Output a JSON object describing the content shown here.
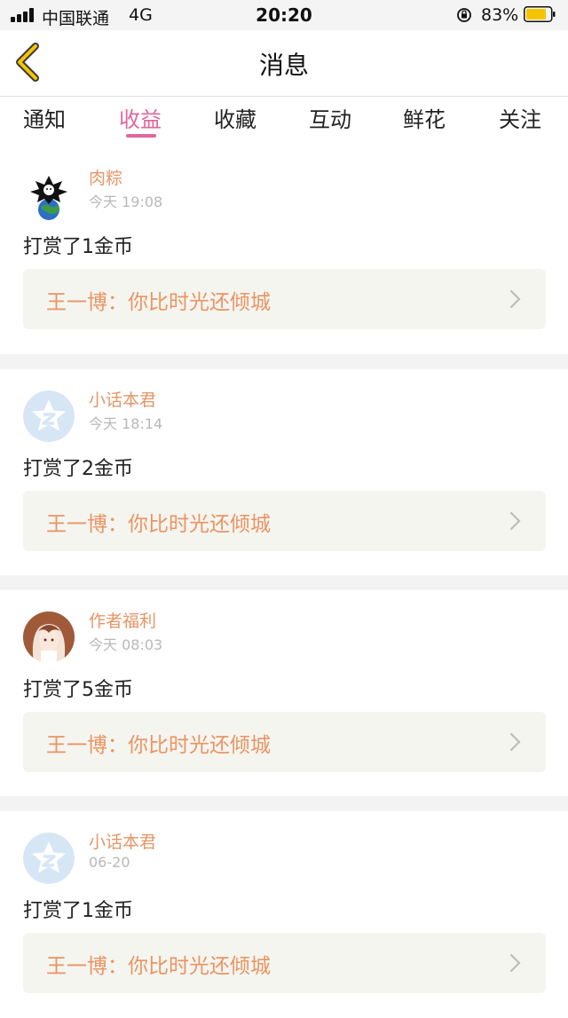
{
  "status_bar": {
    "carrier": "中国联通",
    "network": "4G",
    "time": "20:20",
    "battery": "83%"
  },
  "header": {
    "title": "消息"
  },
  "tabs": [
    {
      "label": "通知"
    },
    {
      "label": "收益",
      "active": true
    },
    {
      "label": "收藏"
    },
    {
      "label": "互动"
    },
    {
      "label": "鲜花"
    },
    {
      "label": "关注"
    }
  ],
  "messages": [
    {
      "user": "肉粽",
      "time": "今天 19:08",
      "action": "打赏了1金币",
      "book": "王一博：你比时光还倾城",
      "avatar": "wolf-earth-avatar"
    },
    {
      "user": "小话本君",
      "time": "今天 18:14",
      "action": "打赏了2金币",
      "book": "王一博：你比时光还倾城",
      "avatar": "default-star-avatar"
    },
    {
      "user": "作者福利",
      "time": "今天 08:03",
      "action": "打赏了5金币",
      "book": "王一博：你比时光还倾城",
      "avatar": "anime-girl-avatar"
    },
    {
      "user": "小话本君",
      "time": "06-20",
      "action": "打赏了1金币",
      "book": "王一博：你比时光还倾城",
      "avatar": "default-star-avatar"
    }
  ],
  "colors": {
    "accent": "#e2659c",
    "username": "#e59668",
    "book_link": "#ea9464",
    "battery": "#f5c400"
  }
}
